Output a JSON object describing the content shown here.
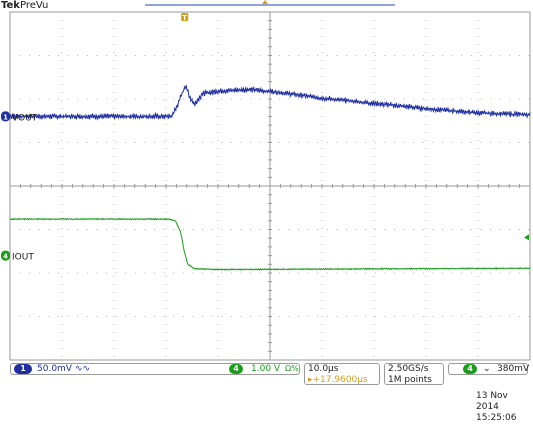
{
  "header": {
    "brand": "Tek",
    "acquisition": "PreVu"
  },
  "channels": [
    {
      "id": "1",
      "label": "VOUT",
      "color": "#1f2fa0",
      "scale": "50.0mV",
      "coupling_icon": "∿∿"
    },
    {
      "id": "4",
      "label": "IOUT",
      "color": "#1a9c1a",
      "scale": "1.00 V",
      "termination": "Ω%"
    }
  ],
  "trigger": {
    "marker": "T",
    "channel": "4",
    "slope_icon": "⌄",
    "level": "380mV"
  },
  "timebase": {
    "horizontal_scale": "10.0µs",
    "delay": "▸+17.9600µs",
    "sample_rate": "2.50GS/s",
    "record_length": "1M points"
  },
  "datetime": {
    "date": "13 Nov 2014",
    "time": "15:25:06"
  },
  "chart_data": {
    "type": "line",
    "title": "",
    "xlabel": "",
    "ylabel": "",
    "grid": true,
    "x_divisions": 10,
    "y_divisions": 8,
    "x_unit_per_div": "10.0µs",
    "series": [
      {
        "name": "VOUT",
        "channel": "1",
        "color": "#1f2fa0",
        "ground_div": 1.6,
        "points_div": [
          [
            0,
            0.0
          ],
          [
            3.1,
            0.0
          ],
          [
            3.2,
            0.2
          ],
          [
            3.3,
            0.5
          ],
          [
            3.38,
            0.72
          ],
          [
            3.45,
            0.45
          ],
          [
            3.55,
            0.28
          ],
          [
            3.7,
            0.52
          ],
          [
            4.0,
            0.58
          ],
          [
            4.6,
            0.62
          ],
          [
            5.2,
            0.55
          ],
          [
            6.0,
            0.42
          ],
          [
            7.0,
            0.3
          ],
          [
            8.0,
            0.18
          ],
          [
            9.0,
            0.08
          ],
          [
            10.0,
            0.04
          ]
        ],
        "noise_div": 0.07
      },
      {
        "name": "IOUT",
        "channel": "4",
        "color": "#1a9c1a",
        "ground_div": -1.6,
        "points_div": [
          [
            0,
            0.84
          ],
          [
            3.05,
            0.84
          ],
          [
            3.18,
            0.8
          ],
          [
            3.28,
            0.55
          ],
          [
            3.35,
            0.1
          ],
          [
            3.42,
            -0.2
          ],
          [
            3.55,
            -0.3
          ],
          [
            4.0,
            -0.32
          ],
          [
            6.0,
            -0.31
          ],
          [
            8.0,
            -0.3
          ],
          [
            10.0,
            -0.29
          ]
        ],
        "noise_div": 0.015
      }
    ]
  }
}
